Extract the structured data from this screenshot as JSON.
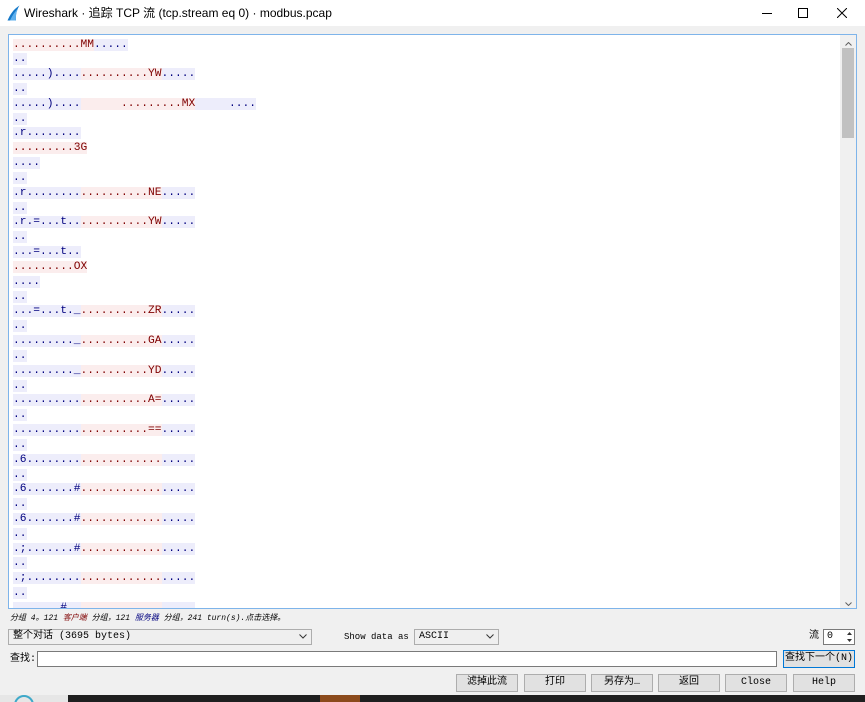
{
  "window": {
    "title": "Wireshark · 追踪 TCP 流 (tcp.stream eq 0) · modbus.pcap"
  },
  "icons": {
    "app": "wireshark-icon",
    "minimize": "minimize-icon",
    "maximize": "maximize-icon",
    "close": "close-icon",
    "dropdown": "chevron-down-icon",
    "scroll_up": "chevron-up-icon",
    "scroll_down": "chevron-down-icon",
    "spin_up": "spin-up-icon",
    "spin_down": "spin-down-icon"
  },
  "colors": {
    "client_fg": "#7f0000",
    "client_bg": "#fbeded",
    "server_fg": "#00007f",
    "server_bg": "#ededfb",
    "focus_border": "#0078d7",
    "window_bg": "#f0f0f0"
  },
  "stream": {
    "lines": [
      [
        {
          "client": "..........MM"
        },
        {
          "server": "....."
        }
      ],
      [
        {
          "server": ".."
        }
      ],
      [
        {
          "server": ".....)...."
        },
        {
          "client": "..........YW"
        },
        {
          "server": "....."
        }
      ],
      [
        {
          "server": ".."
        }
      ],
      [
        {
          "server": ".....)...."
        },
        {
          "client": "      .........MX"
        },
        {
          "server": "     ...."
        }
      ],
      [
        {
          "server": ".."
        }
      ],
      [
        {
          "server": ".r........"
        }
      ],
      [
        {
          "client": ".........3G"
        }
      ],
      [
        {
          "server": "...."
        }
      ],
      [
        {
          "server": ".."
        }
      ],
      [
        {
          "server": ".r........"
        },
        {
          "client": "..........NE"
        },
        {
          "server": "....."
        }
      ],
      [
        {
          "server": ".."
        }
      ],
      [
        {
          "server": ".r.=...t.."
        },
        {
          "client": "..........YW"
        },
        {
          "server": "....."
        }
      ],
      [
        {
          "server": ".."
        }
      ],
      [
        {
          "server": "...=...t.."
        }
      ],
      [
        {
          "client": ".........OX"
        }
      ],
      [
        {
          "server": "...."
        }
      ],
      [
        {
          "server": ".."
        }
      ],
      [
        {
          "server": "...=...t._"
        },
        {
          "client": "..........ZR"
        },
        {
          "server": "....."
        }
      ],
      [
        {
          "server": ".."
        }
      ],
      [
        {
          "server": "........._"
        },
        {
          "client": "..........GA"
        },
        {
          "server": "....."
        }
      ],
      [
        {
          "server": ".."
        }
      ],
      [
        {
          "server": "........._"
        },
        {
          "client": "..........YD"
        },
        {
          "server": "....."
        }
      ],
      [
        {
          "server": ".."
        }
      ],
      [
        {
          "server": ".........."
        },
        {
          "client": "..........A="
        },
        {
          "server": "....."
        }
      ],
      [
        {
          "server": ".."
        }
      ],
      [
        {
          "server": ".........."
        },
        {
          "client": "..........=="
        },
        {
          "server": "....."
        }
      ],
      [
        {
          "server": ".."
        }
      ],
      [
        {
          "server": ".6........"
        },
        {
          "client": "............"
        },
        {
          "server": "....."
        }
      ],
      [
        {
          "server": ".."
        }
      ],
      [
        {
          "server": ".6.......#"
        },
        {
          "client": "............"
        },
        {
          "server": "....."
        }
      ],
      [
        {
          "server": ".."
        }
      ],
      [
        {
          "server": ".6.......#"
        },
        {
          "client": "............"
        },
        {
          "server": "....."
        }
      ],
      [
        {
          "server": ".."
        }
      ],
      [
        {
          "server": ".;.......#"
        },
        {
          "client": "............"
        },
        {
          "server": "....."
        }
      ],
      [
        {
          "server": ".."
        }
      ],
      [
        {
          "server": ".;........"
        },
        {
          "client": "............"
        },
        {
          "server": "....."
        }
      ],
      [
        {
          "server": ".."
        }
      ],
      [
        {
          "server": ".......#.."
        },
        {
          "client": "............"
        },
        {
          "server": "....."
        }
      ]
    ]
  },
  "status": {
    "prefix": "分组 4。121 ",
    "client_label": "客户端",
    "middle": " 分组，121 ",
    "server_label": "服务器",
    "suffix": " 分组，241 turn(s).点击选择。"
  },
  "conversation_select": {
    "value": "整个对话 (3695 bytes)"
  },
  "show_data_as": {
    "label": "Show data as",
    "value": "ASCII"
  },
  "stream_number": {
    "label": "流",
    "value": "0"
  },
  "find": {
    "label": "查找:",
    "value": "",
    "next_button": "查找下一个(N)"
  },
  "buttons": {
    "filter_out": "滤掉此流",
    "print": "打印",
    "save_as": "另存为…",
    "back": "返回",
    "close": "Close",
    "help": "Help"
  }
}
